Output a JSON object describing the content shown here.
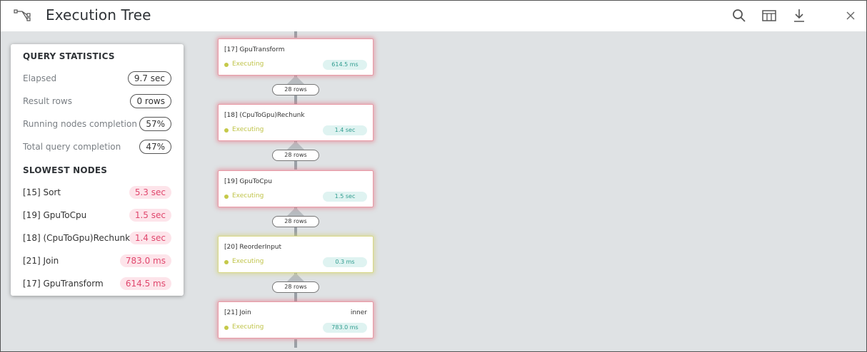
{
  "header": {
    "title": "Execution Tree"
  },
  "colors": {
    "canvas": "#dfe2e4",
    "slow_text": "#e0486e",
    "slow_bg": "#fde4ea",
    "executing": "#c0c44a",
    "time_text": "#2e9c8e",
    "time_bg": "#dff3f1"
  },
  "icons": [
    "execution-tree-icon",
    "search-icon",
    "table-columns-icon",
    "download-icon",
    "close-icon"
  ],
  "query_statistics": {
    "heading": "QUERY STATISTICS",
    "items": [
      {
        "label": "Elapsed",
        "value": "9.7 sec"
      },
      {
        "label": "Result rows",
        "value": "0 rows"
      },
      {
        "label": "Running nodes completion",
        "value": "57%"
      },
      {
        "label": "Total query completion",
        "value": "47%"
      }
    ]
  },
  "slowest_nodes": {
    "heading": "SLOWEST NODES",
    "items": [
      {
        "label": "[15] Sort",
        "value": "5.3 sec"
      },
      {
        "label": "[19] GpuToCpu",
        "value": "1.5 sec"
      },
      {
        "label": "[18] (CpuToGpu)Rechunk",
        "value": "1.4 sec"
      },
      {
        "label": "[21] Join",
        "value": "783.0 ms"
      },
      {
        "label": "[17] GpuTransform",
        "value": "614.5 ms"
      }
    ]
  },
  "tree": {
    "nodes": [
      {
        "title": "[17] GpuTransform",
        "extra": "",
        "status": "Executing",
        "time": "614.5 ms",
        "state": "red"
      },
      {
        "title": "[18] (CpuToGpu)Rechunk",
        "extra": "",
        "status": "Executing",
        "time": "1.4 sec",
        "state": "red"
      },
      {
        "title": "[19] GpuToCpu",
        "extra": "",
        "status": "Executing",
        "time": "1.5 sec",
        "state": "red"
      },
      {
        "title": "[20] ReorderInput",
        "extra": "",
        "status": "Executing",
        "time": "0.3 ms",
        "state": "yellow"
      },
      {
        "title": "[21] Join",
        "extra": "inner",
        "status": "Executing",
        "time": "783.0 ms",
        "state": "red"
      }
    ],
    "edges": [
      {
        "rows": "28 rows"
      },
      {
        "rows": "28 rows"
      },
      {
        "rows": "28 rows"
      },
      {
        "rows": "28 rows"
      }
    ]
  }
}
